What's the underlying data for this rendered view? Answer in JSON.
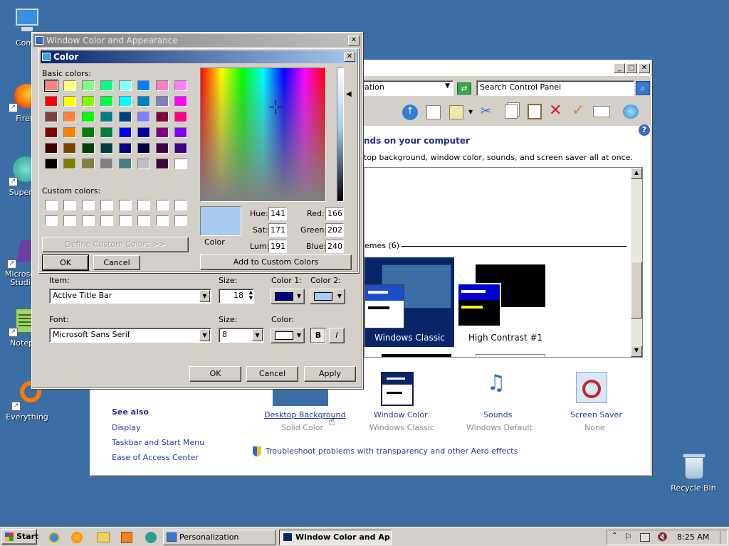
{
  "desktop": {
    "icons": [
      {
        "label": "Comp"
      },
      {
        "label": "Firef"
      },
      {
        "label": "Superm"
      },
      {
        "label": "Microsoft Studio"
      },
      {
        "label": "Notepa"
      },
      {
        "label": "Everything"
      },
      {
        "label": "Recycle Bin"
      }
    ]
  },
  "personalization": {
    "address_fragment": "ation",
    "search_placeholder": "Search Control Panel",
    "heading_fragment": "nds on your computer",
    "desc_fragment": "top background, window color, sounds, and screen saver all at once.",
    "themes_label": "emes (6)",
    "themes": [
      {
        "name": "Windows Classic"
      },
      {
        "name": "High Contrast #1"
      }
    ],
    "tiles": [
      {
        "title": "Desktop Background",
        "subtitle": "Solid Color"
      },
      {
        "title": "Window Color",
        "subtitle": "Windows Classic"
      },
      {
        "title": "Sounds",
        "subtitle": "Windows Default"
      },
      {
        "title": "Screen Saver",
        "subtitle": "None"
      }
    ],
    "see_also": {
      "heading": "See also",
      "links": [
        "Display",
        "Taskbar and Start Menu",
        "Ease of Access Center"
      ]
    },
    "troubleshoot": "Troubleshoot problems with transparency and other Aero effects"
  },
  "appearance": {
    "title": "Window Color and Appearance",
    "item_label": "Item:",
    "item_value": "Active Title Bar",
    "size_label": "Size:",
    "size_value": "18",
    "color1_label": "Color 1:",
    "color2_label": "Color 2:",
    "font_label": "Font:",
    "font_value": "Microsoft Sans Serif",
    "font_size_label": "Size:",
    "font_size_value": "8",
    "font_color_label": "Color:",
    "bold_label": "B",
    "italic_label": "I",
    "ok": "OK",
    "cancel": "Cancel",
    "apply": "Apply",
    "color1": "#000080",
    "color2": "#a6caf0"
  },
  "color_dialog": {
    "title": "Color",
    "basic_colors_label": "Basic colors:",
    "custom_colors_label": "Custom colors:",
    "define_custom": "Define Custom Colors >>",
    "ok": "OK",
    "cancel": "Cancel",
    "add_custom": "Add to Custom Colors",
    "preview_label": "Color",
    "hue_label": "Hue:",
    "hue": "141",
    "sat_label": "Sat:",
    "sat": "171",
    "lum_label": "Lum:",
    "lum": "191",
    "red_label": "Red:",
    "red": "166",
    "green_label": "Green:",
    "green": "202",
    "blue_label": "Blue:",
    "blue": "240",
    "selected_color": "#a6caf0",
    "basic_colors": [
      "#ff8080",
      "#ffff80",
      "#80ff80",
      "#00ff80",
      "#80ffff",
      "#0080ff",
      "#ff80c0",
      "#ff80ff",
      "#ff0000",
      "#ffff00",
      "#80ff00",
      "#00ff40",
      "#00ffff",
      "#0080c0",
      "#8080c0",
      "#ff00ff",
      "#804040",
      "#ff8040",
      "#00ff00",
      "#008080",
      "#004080",
      "#8080ff",
      "#800040",
      "#ff0080",
      "#800000",
      "#ff8000",
      "#008000",
      "#008040",
      "#0000ff",
      "#0000a0",
      "#800080",
      "#8000ff",
      "#400000",
      "#804000",
      "#004000",
      "#004040",
      "#000080",
      "#000040",
      "#400040",
      "#400080",
      "#000000",
      "#808000",
      "#808040",
      "#808080",
      "#408080",
      "#c0c0c0",
      "#400040",
      "#ffffff"
    ]
  },
  "taskbar": {
    "start": "Start",
    "buttons": [
      {
        "label": "Personalization"
      },
      {
        "label": "Window Color and Ap..."
      }
    ],
    "clock": "8:25 AM"
  }
}
